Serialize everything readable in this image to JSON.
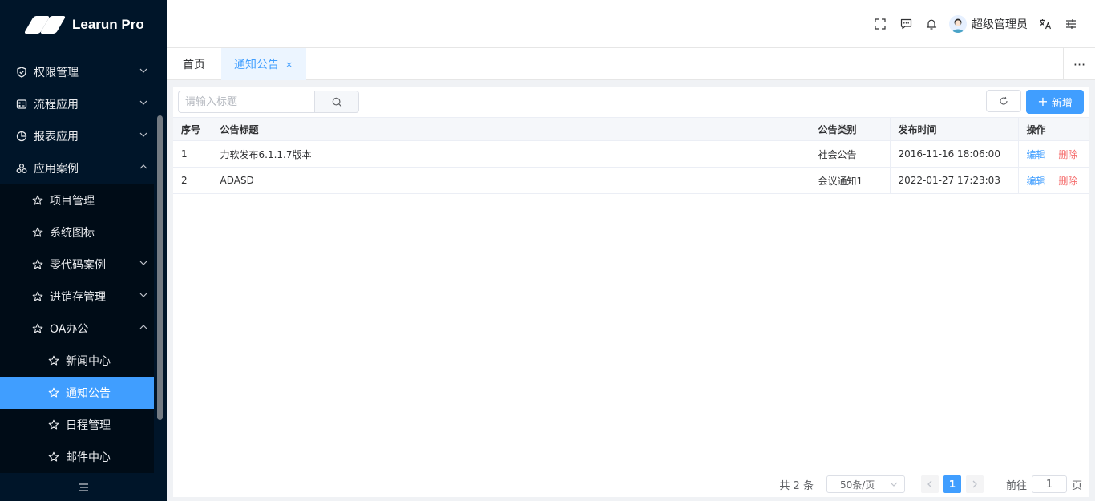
{
  "app": {
    "logo_text": "Learun Pro"
  },
  "sidebar": {
    "items": [
      {
        "label": "权限管理",
        "icon": "shield-icon",
        "expanded": false
      },
      {
        "label": "流程应用",
        "icon": "form-icon",
        "expanded": false
      },
      {
        "label": "报表应用",
        "icon": "pie-chart-icon",
        "expanded": false
      },
      {
        "label": "应用案例",
        "icon": "cluster-icon",
        "expanded": true
      }
    ],
    "sub_items": [
      {
        "label": "项目管理"
      },
      {
        "label": "系统图标"
      },
      {
        "label": "零代码案例"
      },
      {
        "label": "进销存管理"
      },
      {
        "label": "OA办公"
      }
    ],
    "oa_items": [
      {
        "label": "新闻中心"
      },
      {
        "label": "通知公告",
        "active": true
      },
      {
        "label": "日程管理"
      },
      {
        "label": "邮件中心"
      }
    ]
  },
  "header": {
    "user_name": "超级管理员"
  },
  "tabs": {
    "home": "首页",
    "current": "通知公告",
    "close": "×",
    "more": "···"
  },
  "toolbar": {
    "search_placeholder": "请输入标题",
    "add_label": "新增"
  },
  "table": {
    "headers": [
      "序号",
      "公告标题",
      "公告类别",
      "发布时间",
      "操作"
    ],
    "rows": [
      {
        "index": "1",
        "title": "力软发布6.1.1.7版本",
        "category": "社会公告",
        "time": "2016-11-16 18:06:00"
      },
      {
        "index": "2",
        "title": "ADASD",
        "category": "会议通知1",
        "time": "2022-01-27 17:23:03"
      }
    ],
    "edit_label": "编辑",
    "delete_label": "删除"
  },
  "pager": {
    "total": "共 2 条",
    "page_size": "50条/页",
    "current_page": "1",
    "goto_prefix": "前往",
    "goto_value": "1",
    "goto_suffix": "页"
  },
  "colors": {
    "sidebar_bg": "#001529",
    "accent": "#409eff",
    "danger": "#f56c6c"
  }
}
